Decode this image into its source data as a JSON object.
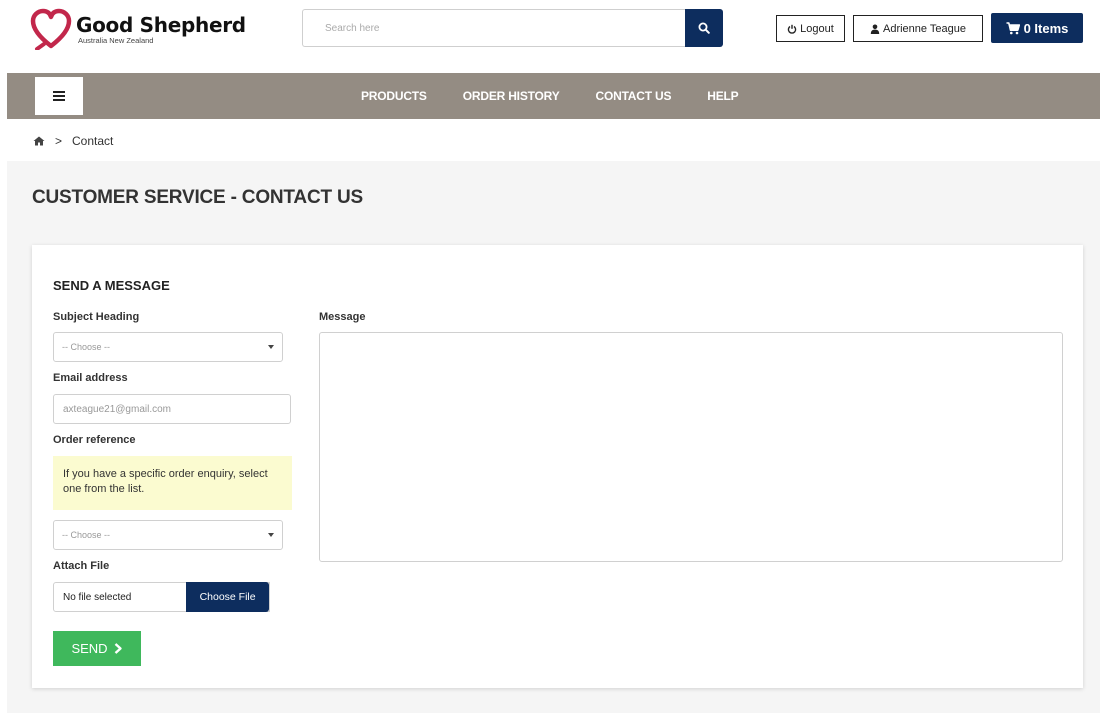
{
  "header": {
    "logo_name": "Good Shepherd",
    "logo_subtitle": "Australia New Zealand",
    "search_placeholder": "Search here",
    "logout_label": "Logout",
    "user_label": "Adrienne Teague",
    "cart_label": "0 Items",
    "accent_color": "#0d2d5e",
    "logo_color": "#c2274b"
  },
  "nav": {
    "bg_color": "#948c83",
    "links": [
      "PRODUCTS",
      "ORDER HISTORY",
      "CONTACT US",
      "HELP"
    ]
  },
  "breadcrumb": {
    "home_icon": "home-icon",
    "separator": ">",
    "current": "Contact"
  },
  "page": {
    "title": "CUSTOMER SERVICE - CONTACT US"
  },
  "form": {
    "title": "SEND A MESSAGE",
    "subject_label": "Subject Heading",
    "subject_value": "-- Choose --",
    "email_label": "Email address",
    "email_value": "axteague21@gmail.com",
    "order_label": "Order reference",
    "order_note": "If you have a specific order enquiry, select one from the list.",
    "order_value": "-- Choose --",
    "attach_label": "Attach File",
    "file_status": "No file selected",
    "file_button": "Choose File",
    "send_label": "SEND",
    "message_label": "Message",
    "send_color": "#3fb85c",
    "note_bg": "#fbfbd0"
  }
}
